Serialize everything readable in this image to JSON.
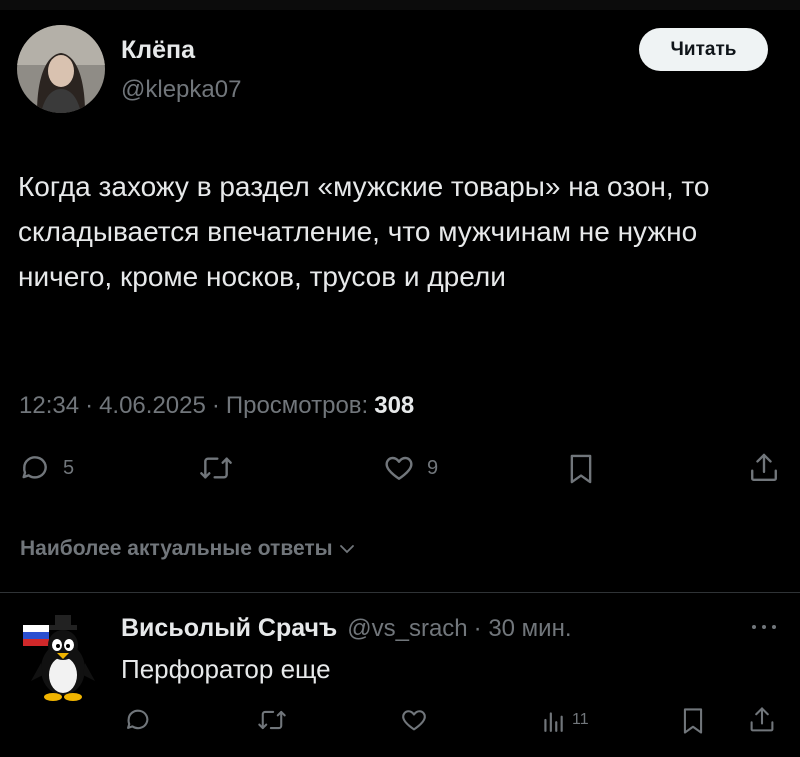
{
  "post": {
    "author_name": "Клёпа",
    "author_handle": "@klepka07",
    "follow_label": "Читать",
    "text": "Когда захожу в раздел «мужские товары» на озон, то складывается впечатление, что мужчинам не нужно ничего, кроме носков, трусов и дрели",
    "time": "12:34",
    "date": "4.06.2025",
    "views_label": "Просмотров:",
    "views_count": "308",
    "separator": "·",
    "actions": {
      "reply_icon": "comment-icon",
      "reply_count": "5",
      "repost_icon": "repost-icon",
      "like_icon": "heart-icon",
      "like_count": "9",
      "bookmark_icon": "bookmark-icon",
      "share_icon": "share-icon"
    }
  },
  "replies_sort": {
    "label": "Наиболее актуальные ответы",
    "icon": "chevron-down-icon"
  },
  "reply": {
    "author_name": "Висьолый Срачъ",
    "author_handle": "@vs_srach",
    "time_ago": "· 30 мин.",
    "text": "Перфоратор еще",
    "more_icon": "more-icon",
    "actions": {
      "reply_icon": "comment-icon",
      "repost_icon": "repost-icon",
      "like_icon": "heart-icon",
      "views_icon": "analytics-icon",
      "views_count": "11",
      "bookmark_icon": "bookmark-icon",
      "share_icon": "share-icon"
    }
  },
  "colors": {
    "background": "#000000",
    "text_primary": "#e7e9ea",
    "text_secondary": "#71767b",
    "divider": "#2f3336",
    "button_bg": "#eff3f4"
  }
}
